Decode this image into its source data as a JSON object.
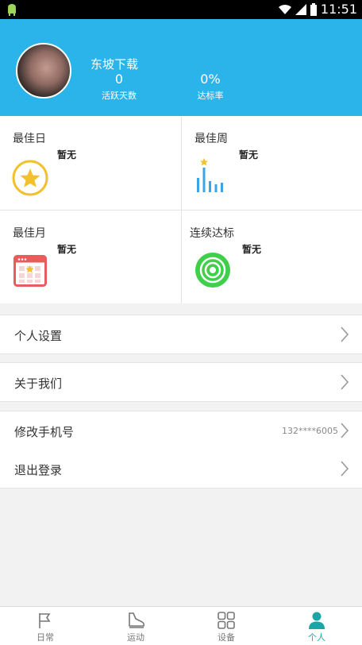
{
  "status_bar": {
    "time": "11:51"
  },
  "profile": {
    "username": "东坡下载",
    "stats": [
      {
        "value": "0",
        "label": "活跃天数"
      },
      {
        "value": "0%",
        "label": "达标率"
      }
    ]
  },
  "records": [
    {
      "title": "最佳日",
      "value": "暂无",
      "icon": "star-circle-icon"
    },
    {
      "title": "最佳周",
      "value": "暂无",
      "icon": "bar-chart-icon"
    },
    {
      "title": "最佳月",
      "value": "暂无",
      "icon": "calendar-icon"
    },
    {
      "title": "连续达标",
      "value": "暂无",
      "icon": "target-icon"
    }
  ],
  "menu": {
    "settings": "个人设置",
    "about": "关于我们",
    "change_phone": "修改手机号",
    "phone_masked": "132****6005",
    "logout": "退出登录"
  },
  "tabs": [
    {
      "label": "日常",
      "icon": "flag-icon"
    },
    {
      "label": "运动",
      "icon": "shoe-icon"
    },
    {
      "label": "设备",
      "icon": "grid-icon"
    },
    {
      "label": "个人",
      "icon": "person-icon",
      "active": true
    }
  ],
  "colors": {
    "header_bg": "#2ab4ea",
    "active_tab": "#1ba6a6"
  }
}
